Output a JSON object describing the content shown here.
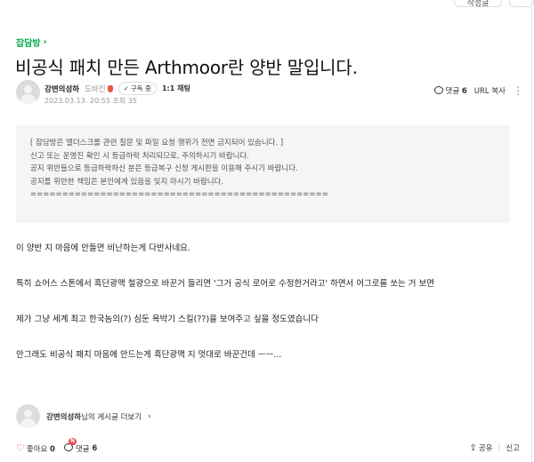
{
  "top_buttons": {
    "btn1": "작성글",
    "btn2": ""
  },
  "post": {
    "board": "잡담방",
    "title": "비공식 패치 만든 Arthmoor란 양반 말입니다.",
    "author": {
      "name": "강변의성하",
      "level": "도바킨",
      "subscribe_label": "구독 중",
      "chat_label": "1:1 채팅",
      "date": "2023.03.13. 20:55",
      "views_label": "조회 35"
    },
    "meta": {
      "comments_label": "댓글",
      "comments_count": "6",
      "url_copy": "URL 복사"
    }
  },
  "notice": {
    "lines": [
      "[ 잡담방은 엘더스크롤 관련 질문 및 파일 요청 행위가 전면 금지되어 있습니다. ]",
      "신고 또는 운영진 확인 시 등급하락 처리되므로, 주의하시기 바랍니다.",
      "공지 위반들으로 등급하락하신 분은 등급복구 신청 게시판을 이용해 주시기 바랍니다.",
      "공지를 위반한 책임은 본인에게 있음을 잊지 마시기 바랍니다.",
      "==============================================="
    ]
  },
  "content": {
    "p1": "이 양반 지 마음에 안들면 비난하는게 다반사네요.",
    "p2": "특히 쇼어스 스톤에서 흑단광맥 철광으로 바꾼거 들리면 '그거 공식 로어로 수정한거라고' 하면서 어그로를 쏘는 거 보면",
    "p3": "제가 그냥 세계 최고 한국놈의(?) 심둔 욕박기 스킬(??)을 보여주고 싶을 정도였습니다",
    "p4": "안그래도 비공식 패치 마음에 안드는게 흑단광맥 지 멋대로 바꾼건데 ㅡㅡ..."
  },
  "author_link": {
    "name": "강변의성하",
    "suffix": "님의 게시글 더보기"
  },
  "footer": {
    "like_label": "좋아요",
    "like_count": "0",
    "comment_label": "댓글",
    "comment_count": "6",
    "new_badge": "N",
    "share_label": "공유",
    "report_label": "신고"
  },
  "colors": {
    "accent": "#03a94f",
    "heart": "#e5484d"
  }
}
